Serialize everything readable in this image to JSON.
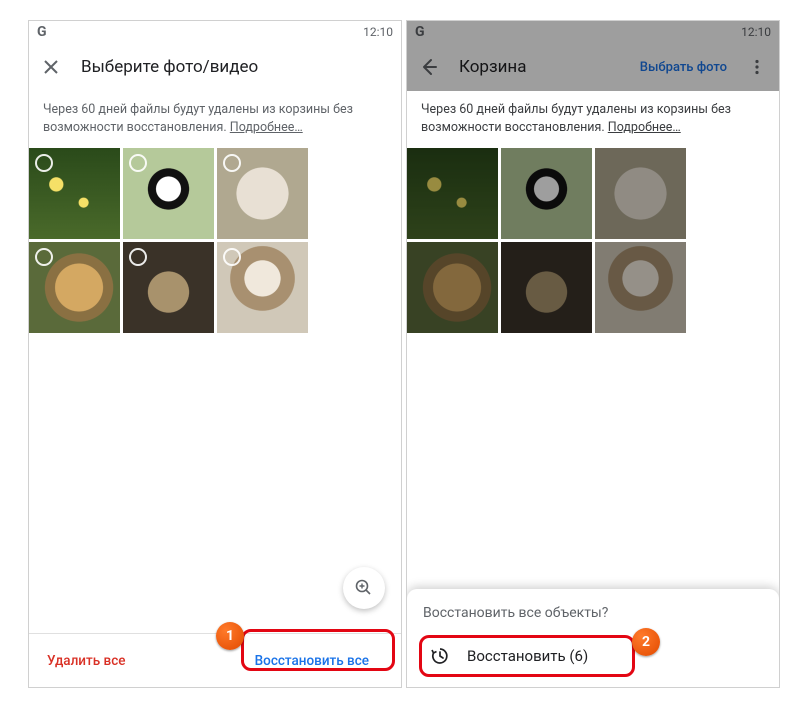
{
  "status": {
    "time": "12:10",
    "brand": "G"
  },
  "left": {
    "title": "Выберите фото/видео",
    "info_text": "Через 60 дней файлы будут удалены из корзины без возможности восстановления. ",
    "info_more": "Подробнее…",
    "delete_all": "Удалить все",
    "restore_all": "Восстановить все"
  },
  "right": {
    "title": "Корзина",
    "select_photo": "Выбрать фото",
    "info_text": "Через 60 дней файлы будут удалены из корзины без возможности восстановления. ",
    "info_more": "Подробнее…",
    "sheet_question": "Восстановить все объекты?",
    "sheet_action": "Восстановить (6)"
  },
  "callouts": {
    "one": "1",
    "two": "2"
  }
}
